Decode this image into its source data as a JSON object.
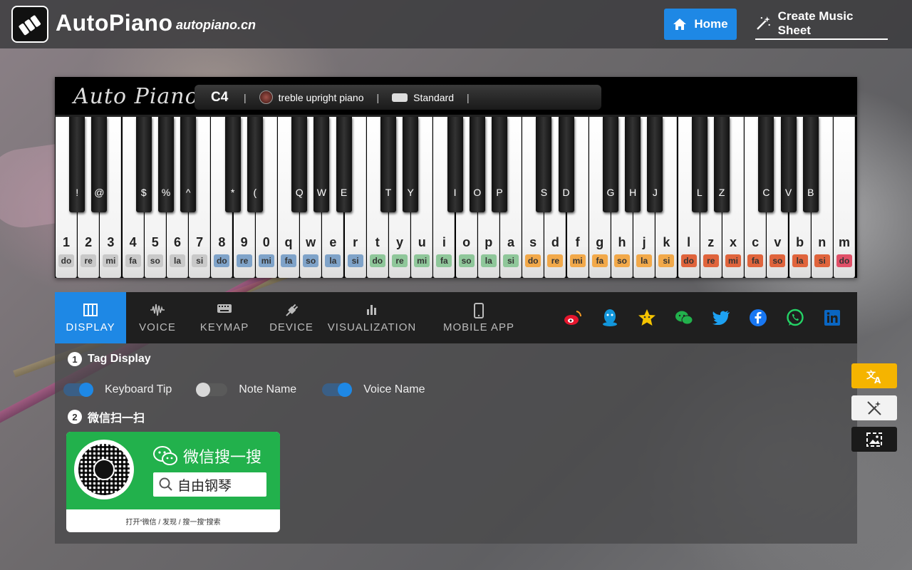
{
  "header": {
    "brand": "AutoPiano",
    "brand_sub": "autopiano.cn",
    "nav_home": "Home",
    "nav_create": "Create Music Sheet"
  },
  "piano": {
    "script_logo": "Auto Piano",
    "status": {
      "note": "C4",
      "instrument": "treble upright piano",
      "mode": "Standard"
    },
    "white_keys": [
      {
        "label": "1",
        "solf": "do",
        "color": "#c9c9c9"
      },
      {
        "label": "2",
        "solf": "re",
        "color": "#c9c9c9"
      },
      {
        "label": "3",
        "solf": "mi",
        "color": "#c9c9c9"
      },
      {
        "label": "4",
        "solf": "fa",
        "color": "#c9c9c9"
      },
      {
        "label": "5",
        "solf": "so",
        "color": "#c9c9c9"
      },
      {
        "label": "6",
        "solf": "la",
        "color": "#c9c9c9"
      },
      {
        "label": "7",
        "solf": "si",
        "color": "#c9c9c9"
      },
      {
        "label": "8",
        "solf": "do",
        "color": "#7fa3c9"
      },
      {
        "label": "9",
        "solf": "re",
        "color": "#7fa3c9"
      },
      {
        "label": "0",
        "solf": "mi",
        "color": "#7fa3c9"
      },
      {
        "label": "q",
        "solf": "fa",
        "color": "#7fa3c9"
      },
      {
        "label": "w",
        "solf": "so",
        "color": "#7fa3c9"
      },
      {
        "label": "e",
        "solf": "la",
        "color": "#7fa3c9"
      },
      {
        "label": "r",
        "solf": "si",
        "color": "#7fa3c9"
      },
      {
        "label": "t",
        "solf": "do",
        "color": "#8fc79a"
      },
      {
        "label": "y",
        "solf": "re",
        "color": "#8fc79a"
      },
      {
        "label": "u",
        "solf": "mi",
        "color": "#8fc79a"
      },
      {
        "label": "i",
        "solf": "fa",
        "color": "#8fc79a"
      },
      {
        "label": "o",
        "solf": "so",
        "color": "#8fc79a"
      },
      {
        "label": "p",
        "solf": "la",
        "color": "#8fc79a"
      },
      {
        "label": "a",
        "solf": "si",
        "color": "#8fc79a"
      },
      {
        "label": "s",
        "solf": "do",
        "color": "#f2a94a"
      },
      {
        "label": "d",
        "solf": "re",
        "color": "#f2a94a"
      },
      {
        "label": "f",
        "solf": "mi",
        "color": "#f2a94a"
      },
      {
        "label": "g",
        "solf": "fa",
        "color": "#f2a94a"
      },
      {
        "label": "h",
        "solf": "so",
        "color": "#f2a94a"
      },
      {
        "label": "j",
        "solf": "la",
        "color": "#f2a94a"
      },
      {
        "label": "k",
        "solf": "si",
        "color": "#f2a94a"
      },
      {
        "label": "l",
        "solf": "do",
        "color": "#e0643c"
      },
      {
        "label": "z",
        "solf": "re",
        "color": "#e0643c"
      },
      {
        "label": "x",
        "solf": "mi",
        "color": "#e0643c"
      },
      {
        "label": "c",
        "solf": "fa",
        "color": "#e0643c"
      },
      {
        "label": "v",
        "solf": "so",
        "color": "#e0643c"
      },
      {
        "label": "b",
        "solf": "la",
        "color": "#e0643c"
      },
      {
        "label": "n",
        "solf": "si",
        "color": "#e0643c"
      },
      {
        "label": "m",
        "solf": "do",
        "color": "#e05068"
      }
    ],
    "black_keys": [
      "!",
      "@",
      "$",
      "%",
      "^",
      "*",
      "(",
      "Q",
      "W",
      "E",
      "T",
      "Y",
      "I",
      "O",
      "P",
      "S",
      "D",
      "G",
      "H",
      "J",
      "L",
      "Z",
      "C",
      "V",
      "B"
    ]
  },
  "tabs": [
    {
      "label": "DISPLAY",
      "icon": "piano-icon",
      "active": true
    },
    {
      "label": "VOICE",
      "icon": "waveform-icon",
      "active": false
    },
    {
      "label": "KEYMAP",
      "icon": "keyboard-icon",
      "active": false
    },
    {
      "label": "DEVICE",
      "icon": "plug-icon",
      "active": false
    },
    {
      "label": "VISUALIZATION",
      "icon": "bar-chart-icon",
      "active": false
    },
    {
      "label": "MOBILE APP",
      "icon": "phone-icon",
      "active": false
    }
  ],
  "social": [
    {
      "name": "weibo-icon",
      "color": "#e6162d"
    },
    {
      "name": "qq-icon",
      "color": "#1296db"
    },
    {
      "name": "qzone-icon",
      "color": "#f5c400"
    },
    {
      "name": "wechat-icon",
      "color": "#22b14c"
    },
    {
      "name": "twitter-icon",
      "color": "#1da1f2"
    },
    {
      "name": "facebook-icon",
      "color": "#1877f2"
    },
    {
      "name": "whatsapp-icon",
      "color": "#25d366"
    },
    {
      "name": "linkedin-icon",
      "color": "#0a66c2"
    }
  ],
  "display": {
    "section1_title": "Tag Display",
    "section1_num": "1",
    "toggles": [
      {
        "label": "Keyboard Tip",
        "on": true
      },
      {
        "label": "Note Name",
        "on": false
      },
      {
        "label": "Voice Name",
        "on": true
      }
    ],
    "section2_title": "微信扫一扫",
    "section2_num": "2",
    "wechat": {
      "title": "微信搜一搜",
      "search": "自由钢琴",
      "footer": "打开“微信 / 发现 / 搜一搜”搜索"
    }
  },
  "colors": {
    "accent": "#1e88e5",
    "translate_btn": "#f5b400"
  }
}
